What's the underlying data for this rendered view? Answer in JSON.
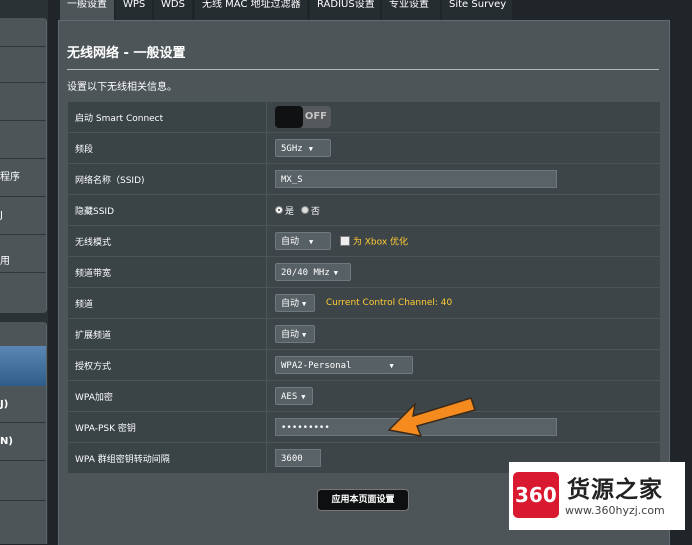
{
  "sidebar": {
    "items": [
      {
        "label": "程序"
      },
      {
        "label": "J"
      },
      {
        "label": "用"
      },
      {
        "label": "J)"
      },
      {
        "label": "N)"
      }
    ]
  },
  "tabs": [
    {
      "label": "一般设置"
    },
    {
      "label": "WPS"
    },
    {
      "label": "WDS"
    },
    {
      "label": "无线 MAC 地址过滤器"
    },
    {
      "label": "RADIUS设置"
    },
    {
      "label": "专业设置"
    },
    {
      "label": "Site Survey"
    }
  ],
  "page": {
    "title": "无线网络 - 一般设置",
    "subtitle": "设置以下无线相关信息。"
  },
  "form": {
    "smart_connect": {
      "label": "启动 Smart Connect",
      "state": "OFF"
    },
    "band": {
      "label": "频段",
      "value": "5GHz"
    },
    "ssid": {
      "label": "网络名称（SSID)",
      "value": "MX_S"
    },
    "hide_ssid": {
      "label": "隐藏SSID",
      "yes": "是",
      "no": "否"
    },
    "wireless_mode": {
      "label": "无线模式",
      "value": "自动",
      "xbox_note": "为 Xbox 优化"
    },
    "bandwidth": {
      "label": "频道带宽",
      "value": "20/40 MHz"
    },
    "channel": {
      "label": "频道",
      "value": "自动",
      "note": "Current Control Channel: 40"
    },
    "ext_channel": {
      "label": "扩展频道",
      "value": "自动"
    },
    "auth_method": {
      "label": "授权方式",
      "value": "WPA2-Personal"
    },
    "wpa_encryption": {
      "label": "WPA加密",
      "value": "AES"
    },
    "psk": {
      "label": "WPA-PSK 密钥",
      "value": "•••••••••"
    },
    "rekey": {
      "label": "WPA 群组密钥转动间隔",
      "value": "3600"
    }
  },
  "apply_button": "应用本页面设置",
  "watermark": {
    "logo": "360",
    "name": "货源之家",
    "url": "www.360hyzj.com"
  },
  "colors": {
    "accent_note": "#ffcc33",
    "arrow": "#f58a1f",
    "logo_red": "#d9192f"
  }
}
